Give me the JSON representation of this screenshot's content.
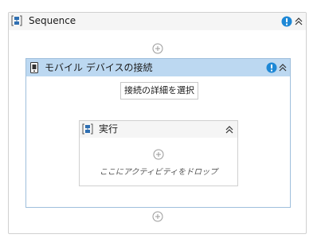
{
  "sequence": {
    "title": "Sequence"
  },
  "connect_activity": {
    "title": "モバイル デバイスの接続",
    "select_button_label": "接続の詳細を選択"
  },
  "execute_scope": {
    "title": "実行",
    "drop_hint": "ここにアクティビティをドロップ"
  },
  "icons": {
    "sequence": "sequence-icon",
    "device": "mobile-device-icon",
    "warning": "warning-icon",
    "collapse": "chevron-up-double-icon",
    "add": "add-activity-icon"
  },
  "colors": {
    "warning": "#1e88d6",
    "activity_header": "#bcd8f1",
    "activity_border": "#9fbfdc",
    "sequence_icon": "#2f6fb2"
  }
}
